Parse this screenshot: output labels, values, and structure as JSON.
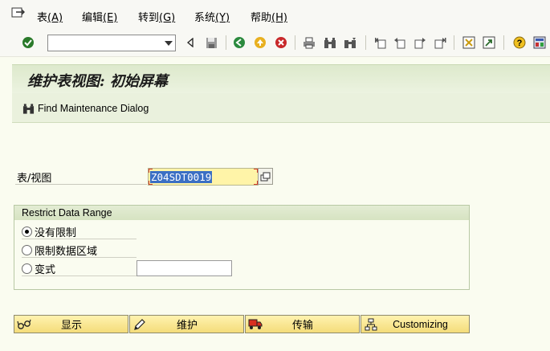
{
  "menu": [
    {
      "label": "表",
      "key": "(A)"
    },
    {
      "label": "编辑",
      "key": "(E)"
    },
    {
      "label": "转到",
      "key": "(G)"
    },
    {
      "label": "系统",
      "key": "(Y)"
    },
    {
      "label": "帮助",
      "key": "(H)"
    }
  ],
  "toolbar": {
    "command_field": {
      "value": "",
      "placeholder": ""
    },
    "icons": [
      "enter-icon",
      "back-icon",
      "save-icon",
      "back-nav-icon",
      "exit-icon",
      "cancel-icon",
      "print-icon",
      "find-icon",
      "find-next-icon",
      "first-page-icon",
      "prev-page-icon",
      "next-page-icon",
      "last-page-icon",
      "create-session-icon",
      "shortcut-icon",
      "help-icon",
      "layout-icon"
    ]
  },
  "title": "维护表视图: 初始屏幕",
  "app_toolbar": {
    "find_label": "Find Maintenance Dialog"
  },
  "table_field": {
    "label": "表/视图",
    "value": "Z04SDT0019"
  },
  "restrict": {
    "title": "Restrict Data Range",
    "options": [
      {
        "label": "没有限制",
        "selected": true
      },
      {
        "label": "限制数据区域",
        "selected": false
      },
      {
        "label": "变式",
        "selected": false
      }
    ],
    "variant_value": ""
  },
  "buttons": {
    "display": "显示",
    "maintain": "维护",
    "transport": "传输",
    "customizing": "Customizing"
  },
  "colors": {
    "background": "#fafcf0",
    "title_bar": "#dde9cc",
    "input_highlight": "#fff4a8",
    "button": "#f4dc7a",
    "selection": "#3b6fc4"
  }
}
